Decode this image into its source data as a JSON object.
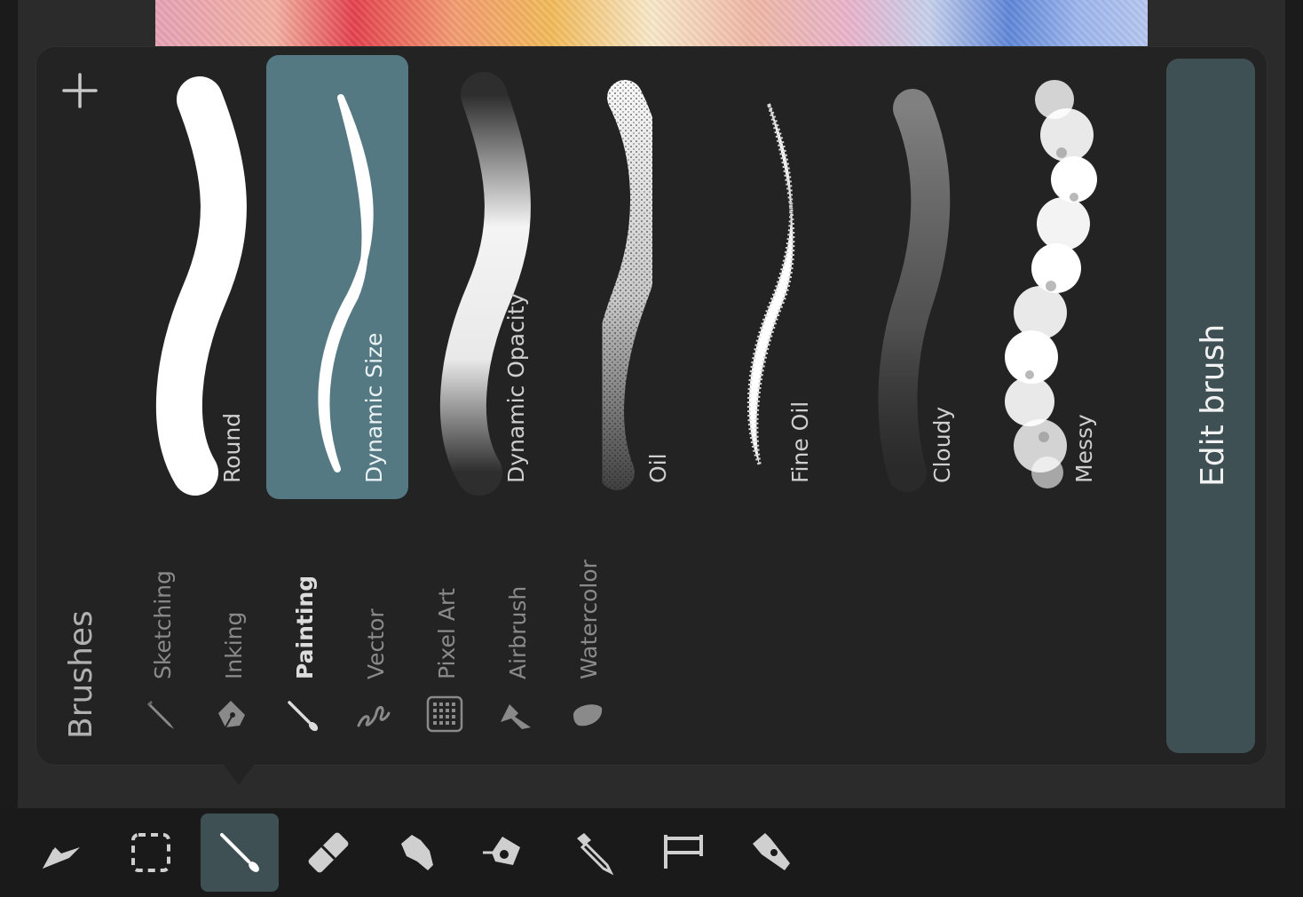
{
  "panel": {
    "title": "Brushes",
    "add_label": "+",
    "edit_button": "Edit brush"
  },
  "brushes": [
    {
      "label": "Round",
      "selected": false
    },
    {
      "label": "Dynamic Size",
      "selected": true
    },
    {
      "label": "Dynamic Opacity",
      "selected": false
    },
    {
      "label": "Oil",
      "selected": false
    },
    {
      "label": "Fine Oil",
      "selected": false
    },
    {
      "label": "Cloudy",
      "selected": false
    },
    {
      "label": "Messy",
      "selected": false
    }
  ],
  "categories": [
    {
      "label": "Sketching",
      "icon": "pencil-icon",
      "active": false
    },
    {
      "label": "Inking",
      "icon": "fountain-pen-icon",
      "active": false
    },
    {
      "label": "Painting",
      "icon": "paintbrush-icon",
      "active": true
    },
    {
      "label": "Vector",
      "icon": "squiggle-icon",
      "active": false
    },
    {
      "label": "Pixel Art",
      "icon": "pixel-grid-icon",
      "active": false
    },
    {
      "label": "Airbrush",
      "icon": "airbrush-icon",
      "active": false
    },
    {
      "label": "Watercolor",
      "icon": "water-drop-icon",
      "active": false
    }
  ],
  "toolbar": [
    {
      "icon": "pointer-icon",
      "active": false
    },
    {
      "icon": "selection-icon",
      "active": false
    },
    {
      "icon": "brush-tool-icon",
      "active": true
    },
    {
      "icon": "eraser-icon",
      "active": false
    },
    {
      "icon": "smudge-icon",
      "active": false
    },
    {
      "icon": "fill-bucket-icon",
      "active": false
    },
    {
      "icon": "eyedropper-icon",
      "active": false
    },
    {
      "icon": "text-tool-icon",
      "active": false
    },
    {
      "icon": "pen-tool-icon",
      "active": false
    }
  ],
  "colors": {
    "accent": "#547983",
    "edit_button": "#3f5054",
    "panel": "#232323"
  }
}
